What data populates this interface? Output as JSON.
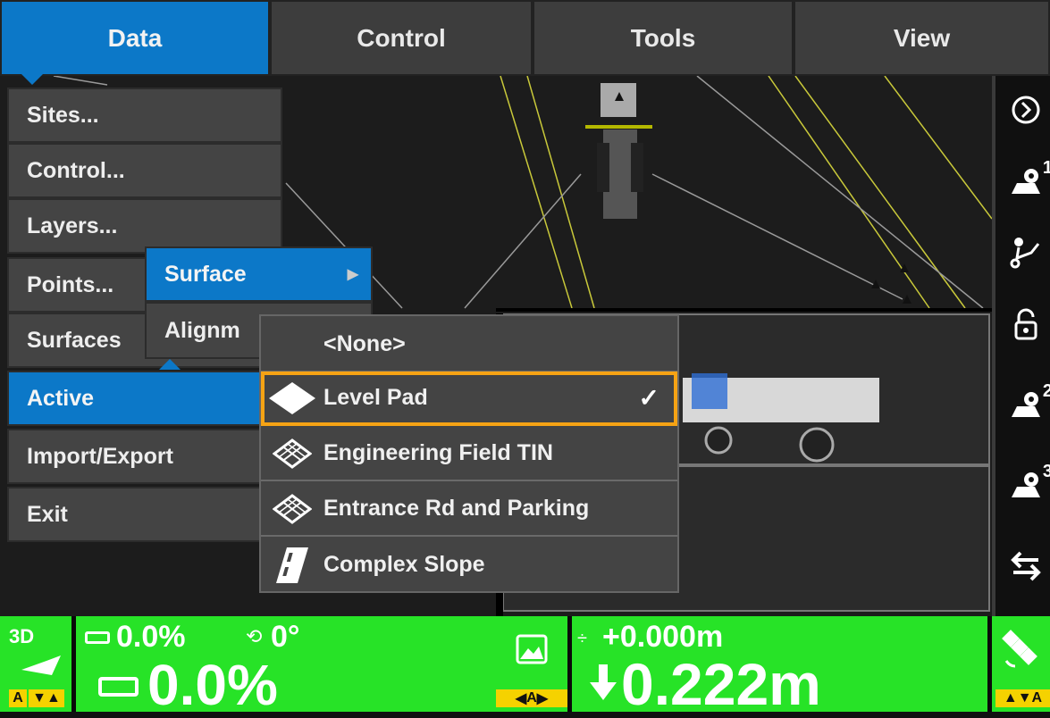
{
  "tabs": [
    {
      "label": "Data",
      "active": true
    },
    {
      "label": "Control",
      "active": false
    },
    {
      "label": "Tools",
      "active": false
    },
    {
      "label": "View",
      "active": false
    }
  ],
  "data_menu": {
    "items": [
      {
        "label": "Sites...",
        "active": false
      },
      {
        "label": "Control...",
        "active": false
      },
      {
        "label": "Layers...",
        "active": false
      },
      {
        "label": "Points...",
        "active": false
      },
      {
        "label": "Surfaces",
        "active": false
      },
      {
        "label": "Active",
        "active": true
      },
      {
        "label": "Import/Export",
        "active": false
      },
      {
        "label": "Exit",
        "active": false
      }
    ]
  },
  "active_submenu": {
    "items": [
      {
        "label": "Surface",
        "active": true,
        "has_arrow": true
      },
      {
        "label": "Alignm",
        "active": false
      }
    ]
  },
  "surface_menu": {
    "items": [
      {
        "label": "<None>",
        "icon": "none",
        "selected": false
      },
      {
        "label": "Level Pad",
        "icon": "diamond-solid-icon",
        "selected": true,
        "check": "✓"
      },
      {
        "label": "Engineering Field TIN",
        "icon": "tin-grid-icon",
        "selected": false
      },
      {
        "label": "Entrance Rd and Parking",
        "icon": "tin-grid-icon",
        "selected": false
      },
      {
        "label": "Complex Slope",
        "icon": "road-icon",
        "selected": false
      }
    ]
  },
  "sidebar": {
    "buttons": [
      {
        "icon": "expand-arrow-icon",
        "sup": ""
      },
      {
        "icon": "map-pin-1-icon",
        "sup": "1"
      },
      {
        "icon": "route-icon",
        "sup": ""
      },
      {
        "icon": "lock-icon",
        "sup": ""
      },
      {
        "icon": "map-pin-2-icon",
        "sup": "2"
      },
      {
        "icon": "map-pin-3-icon",
        "sup": "3"
      },
      {
        "icon": "swap-arrows-icon",
        "sup": ""
      }
    ]
  },
  "status": {
    "mode_label": "3D",
    "slope_small": "0.0%",
    "rotation_small": "0°",
    "slope_big": "0.0%",
    "elev_small": "+0.000m",
    "elev_big": "0.222m",
    "tag_a1": "A",
    "tag_a2": "A",
    "tag_a3": "A"
  },
  "colors": {
    "accent": "#0c78c8",
    "highlight": "#f6a314",
    "status_green": "#27e327"
  }
}
